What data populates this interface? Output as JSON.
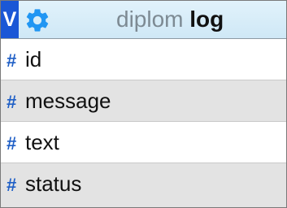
{
  "header": {
    "toggle_label": "V",
    "gear_icon": "gear-icon",
    "database": "diplom",
    "table": "log",
    "accent_color": "#1a57d6",
    "icon_color": "#2196f3"
  },
  "columns": [
    {
      "marker": "#",
      "name": "id"
    },
    {
      "marker": "#",
      "name": "message"
    },
    {
      "marker": "#",
      "name": "text"
    },
    {
      "marker": "#",
      "name": "status"
    }
  ]
}
